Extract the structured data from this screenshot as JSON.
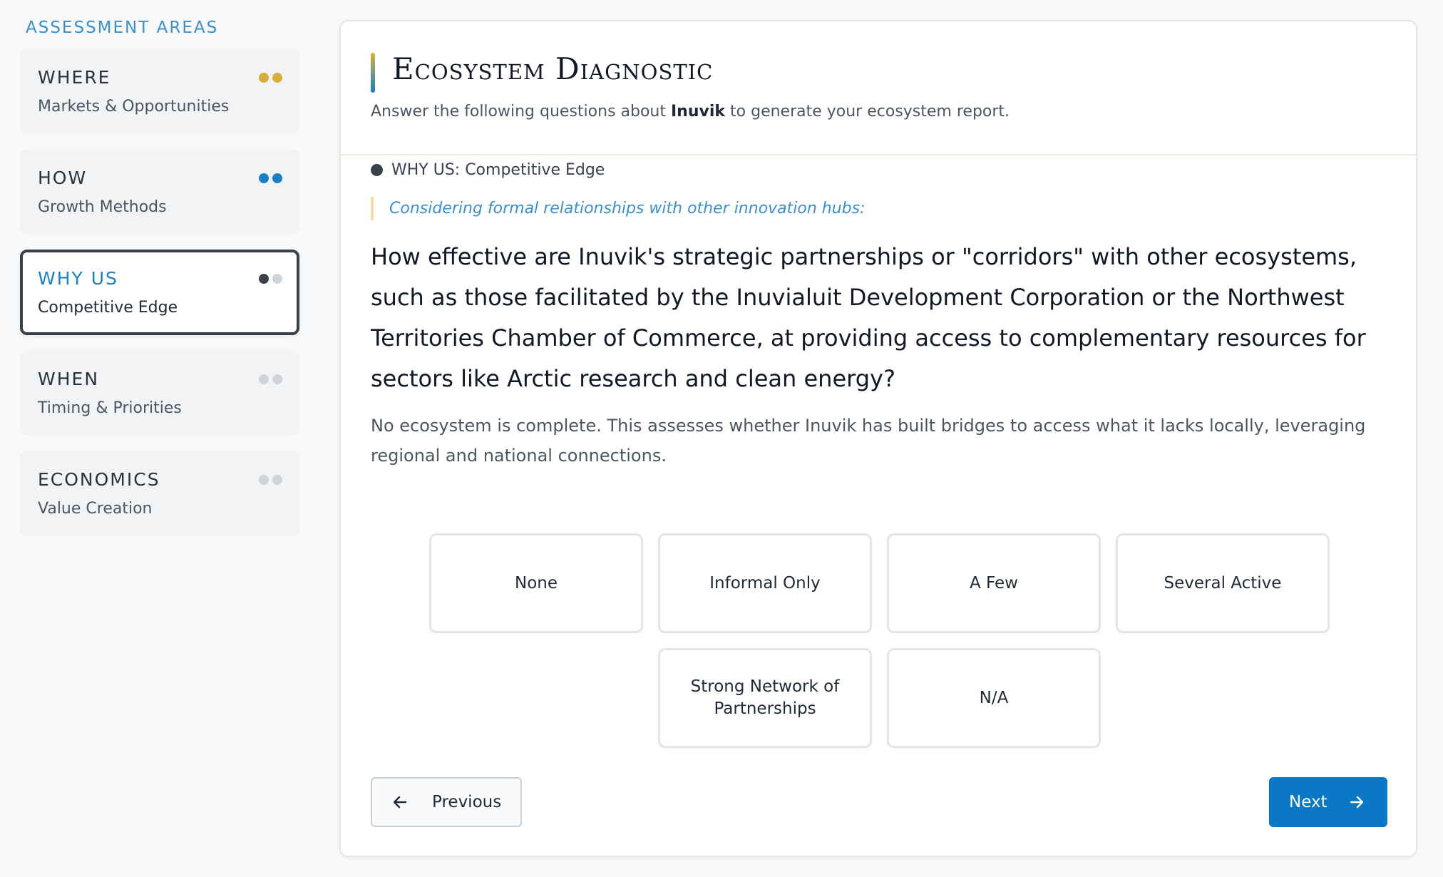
{
  "sidebar": {
    "title": "ASSESSMENT AREAS",
    "areas": [
      {
        "name": "WHERE",
        "subtitle": "Markets & Opportunities",
        "dots": [
          "#d4b03a",
          "#d4b03a"
        ],
        "active": false
      },
      {
        "name": "HOW",
        "subtitle": "Growth Methods",
        "dots": [
          "#1a7fc4",
          "#1a7fc4"
        ],
        "active": false
      },
      {
        "name": "WHY US",
        "subtitle": "Competitive Edge",
        "dots": [
          "#3b4148",
          "#cfd4da"
        ],
        "active": true
      },
      {
        "name": "WHEN",
        "subtitle": "Timing & Priorities",
        "dots": [
          "#cfd4da",
          "#cfd4da"
        ],
        "active": false
      },
      {
        "name": "ECONOMICS",
        "subtitle": "Value Creation",
        "dots": [
          "#cfd4da",
          "#cfd4da"
        ],
        "active": false
      }
    ]
  },
  "header": {
    "title": "Ecosystem Diagnostic",
    "subtitle_before": "Answer the following questions about ",
    "subtitle_entity": "Inuvik",
    "subtitle_after": " to generate your ecosystem report."
  },
  "question": {
    "section": "WHY US: Competitive Edge",
    "context": "Considering formal relationships with other innovation hubs:",
    "text": "How effective are Inuvik's strategic partnerships or \"corridors\" with other ecosystems, such as those facilitated by the Inuvialuit Development Corporation or the Northwest Territories Chamber of Commerce, at providing access to complementary resources for sectors like Arctic research and clean energy?",
    "help": "No ecosystem is complete. This assesses whether Inuvik has built bridges to access what it lacks locally, leveraging regional and national connections."
  },
  "options": [
    "None",
    "Informal Only",
    "A Few",
    "Several Active",
    "Strong Network of Partnerships",
    "N/A"
  ],
  "nav": {
    "previous": "Previous",
    "next": "Next"
  },
  "colors": {
    "accent": "#0a78c4",
    "gold": "#d4b03a",
    "dark": "#3b4148"
  }
}
